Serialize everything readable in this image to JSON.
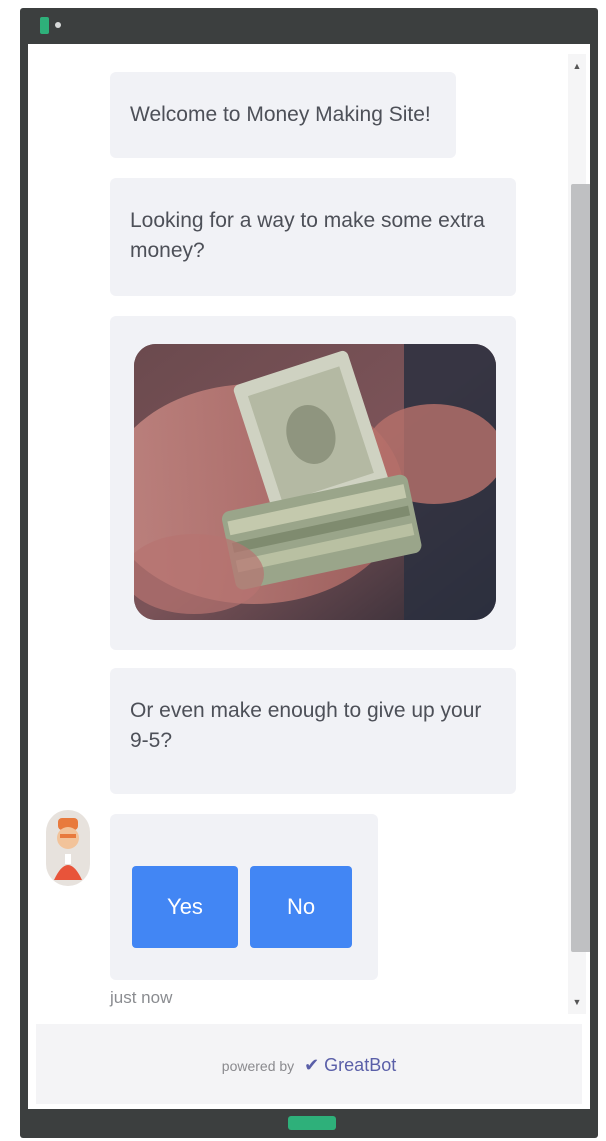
{
  "chat": {
    "messages": [
      {
        "text": "Welcome to Money Making Site!"
      },
      {
        "text": "Looking for a way to make some extra money?"
      },
      {
        "image": "money-cash-photo"
      },
      {
        "text": "Or even make enough to give up your 9-5?"
      }
    ],
    "quick_replies": {
      "yes_label": "Yes",
      "no_label": "No"
    },
    "timestamp": "just now"
  },
  "footer": {
    "powered_by": "powered by",
    "brand_icon": "✔",
    "brand_name": "GreatBot"
  },
  "colors": {
    "accent": "#4286f4",
    "bubble_bg": "#f1f2f6",
    "frame": "#3c3f3f",
    "handle": "#2eb07a",
    "brand": "#5a5fa8"
  },
  "icons": [
    "window-app-icon",
    "scroll-up-arrow-icon",
    "scroll-down-arrow-icon",
    "bot-avatar",
    "brand-check-icon"
  ]
}
